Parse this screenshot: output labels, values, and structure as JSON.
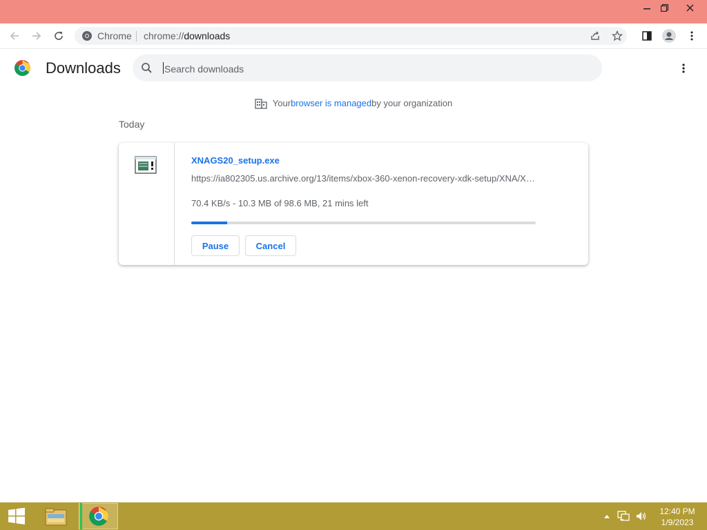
{
  "window": {
    "minimize_glyph": "—",
    "maximize_icon": "restore-icon",
    "close_glyph": "✕"
  },
  "toolbar": {
    "omnibox_site": "Chrome",
    "omnibox_url_prefix": "chrome://",
    "omnibox_url_host": "downloads"
  },
  "page": {
    "title": "Downloads",
    "search_placeholder": "Search downloads",
    "managed_prefix": "Your ",
    "managed_link": "browser is managed",
    "managed_suffix": " by your organization",
    "date_label": "Today"
  },
  "download": {
    "file_name": "XNAGS20_setup.exe",
    "url": "https://ia802305.us.archive.org/13/items/xbox-360-xenon-recovery-xdk-setup/XNA/XNAGS20_setup.exe",
    "status": "70.4 KB/s - 10.3 MB of 98.6 MB, 21 mins left",
    "progress_fraction": 0.1045,
    "pause_label": "Pause",
    "cancel_label": "Cancel"
  },
  "taskbar": {
    "time": "12:40 PM",
    "date": "1/9/2023"
  },
  "colors": {
    "titlebar": "#f28b82",
    "accent": "#1a73e8",
    "taskbar": "#b29c35"
  }
}
